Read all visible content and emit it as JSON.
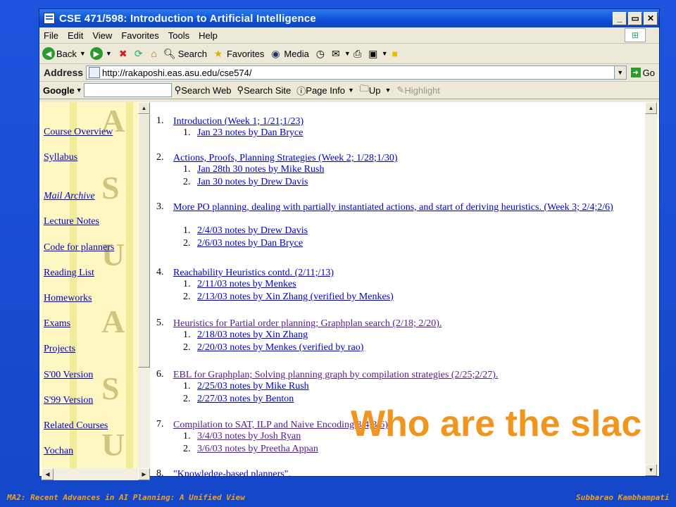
{
  "window": {
    "title": "CSE 471/598: Introduction to Artificial Intelligence",
    "controls": [
      "_",
      "▭",
      "✕"
    ]
  },
  "menu": [
    "File",
    "Edit",
    "View",
    "Favorites",
    "Tools",
    "Help"
  ],
  "toolbar": {
    "back": "Back",
    "search": "Search",
    "favorites": "Favorites",
    "media": "Media"
  },
  "address": {
    "label": "Address",
    "url": "http://rakaposhi.eas.asu.edu/cse574/",
    "go": "Go"
  },
  "google": {
    "logo": "Google",
    "search_web": "Search Web",
    "search_site": "Search Site",
    "page_info": "Page Info",
    "up": "Up",
    "highlight": "Highlight"
  },
  "sidebar": {
    "links": [
      {
        "label": "Course Overview"
      },
      {
        "label": "Syllabus"
      },
      {
        "label": "Mail Archive"
      },
      {
        "label": "Lecture Notes"
      },
      {
        "label": "Code for planners"
      },
      {
        "label": "Reading List"
      },
      {
        "label": "Homeworks"
      },
      {
        "label": "Exams"
      },
      {
        "label": "Projects"
      },
      {
        "label": "S'00 Version"
      },
      {
        "label": "S'99 Version"
      },
      {
        "label": "Related Courses"
      },
      {
        "label": "Yochan"
      }
    ]
  },
  "notes": [
    {
      "num": "1.",
      "title": "Introduction (Week 1; 1/21;1/23)",
      "subs": [
        {
          "n": "1.",
          "label": "Jan 23 notes by Dan Bryce"
        }
      ]
    },
    {
      "num": "2.",
      "title": "Actions, Proofs, Planning Strategies (Week 2; 1/28;1/30)",
      "subs": [
        {
          "n": "1.",
          "label": "Jan 28th 30 notes by Mike Rush"
        },
        {
          "n": "2.",
          "label": "Jan 30 notes by Drew Davis"
        }
      ]
    },
    {
      "num": "3.",
      "title": "More PO planning, dealing with partially instantiated actions, and start of deriving heuristics. (Week 3; 2/4;2/6)",
      "subs": [
        {
          "n": "1.",
          "label": "2/4/03 notes by Drew Davis"
        },
        {
          "n": "2.",
          "label": "2/6/03 notes by Dan Bryce"
        }
      ]
    },
    {
      "num": "4.",
      "title": "Reachability Heuristics contd. (2/11;/13)",
      "subs": [
        {
          "n": "1.",
          "label": "2/11/03 notes by Menkes"
        },
        {
          "n": "2.",
          "label": "2/13/03 notes by Xin Zhang (verified by Menkes)"
        }
      ]
    },
    {
      "num": "5.",
      "title": "Heuristics for Partial order planning; Graphplan search (2/18; 2/20).",
      "subs": [
        {
          "n": "1.",
          "label": "2/18/03 notes by Xin Zhang"
        },
        {
          "n": "2.",
          "label": "2/20/03 notes by Menkes (verified by rao)"
        }
      ]
    },
    {
      "num": "6.",
      "title": "EBL for Graphplan; Solving planning graph by compilation strategies (2/25;2/27).",
      "subs": [
        {
          "n": "1.",
          "label": "2/25/03 notes by Mike Rush"
        },
        {
          "n": "2.",
          "label": "2/27/03 notes by Benton"
        }
      ]
    },
    {
      "num": "7.",
      "title": "Compilation to SAT, ILP and Naive Encoding 3/4;3/6)",
      "subs": [
        {
          "n": "1.",
          "label": "3/4/03 notes by Josh Ryan"
        },
        {
          "n": "2.",
          "label": "3/6/03 notes by Preetha Appan"
        }
      ]
    },
    {
      "num": "8.",
      "title": "\"Knowledge-based planners\".",
      "subs": []
    }
  ],
  "overlay_text": "Who are the slac",
  "footer": {
    "left": "MA2: Recent Advances in AI Planning: A Unified View",
    "right": "Subbarao Kambhampati"
  },
  "colors": {
    "slide_bg": "#1a4fd8",
    "overlay": "#f0961e",
    "link": "#0000cc",
    "visited": "#551a8b"
  }
}
